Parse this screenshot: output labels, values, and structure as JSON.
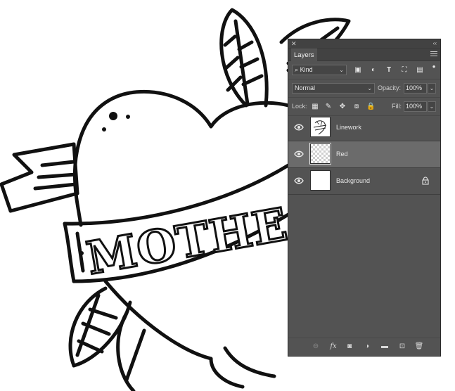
{
  "panel": {
    "close_glyph": "✕",
    "collapse_glyph": "‹‹",
    "tab_label": "Layers",
    "menu_icon": "panel-menu-icon"
  },
  "filter": {
    "kind_label": "Kind",
    "icons": [
      "pixel-filter-icon",
      "adjustment-filter-icon",
      "type-filter-icon",
      "shape-filter-icon",
      "smart-object-filter-icon",
      "filter-toggle-icon"
    ]
  },
  "blend": {
    "mode": "Normal",
    "opacity_label": "Opacity:",
    "opacity_value": "100%"
  },
  "lock": {
    "label": "Lock:",
    "icons": [
      "lock-transparent-icon",
      "lock-image-icon",
      "lock-position-icon",
      "lock-artboard-icon",
      "lock-all-icon"
    ],
    "fill_label": "Fill:",
    "fill_value": "100%"
  },
  "layers": [
    {
      "name": "Linework",
      "visible": true,
      "selected": false,
      "thumb": "linework",
      "locked": false
    },
    {
      "name": "Red",
      "visible": true,
      "selected": true,
      "thumb": "transparent",
      "locked": false
    },
    {
      "name": "Background",
      "visible": true,
      "selected": false,
      "thumb": "white",
      "locked": true
    }
  ],
  "bottom_bar": {
    "icons": [
      "link-layers-icon",
      "fx-icon",
      "add-mask-icon",
      "adjustment-layer-icon",
      "group-folder-icon",
      "new-layer-icon",
      "trash-icon"
    ],
    "fx_glyph": "fx"
  },
  "artwork": {
    "banner_text": "MOTHE"
  }
}
